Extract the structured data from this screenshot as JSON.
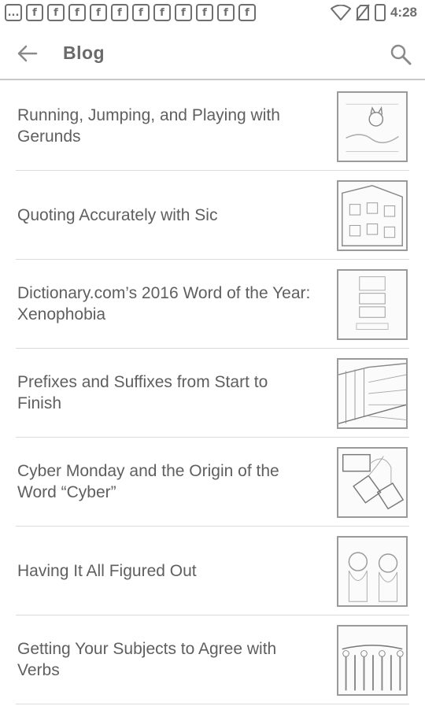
{
  "status_bar": {
    "notification_icons": [
      "...",
      "f",
      "f",
      "f",
      "f",
      "f",
      "f",
      "f",
      "f",
      "f",
      "f",
      "f"
    ],
    "time": "4:28"
  },
  "toolbar": {
    "title": "Blog"
  },
  "posts": [
    {
      "title": "Running, Jumping, and Playing with Gerunds",
      "thumb": "cat-illustration"
    },
    {
      "title": "Quoting Accurately with Sic",
      "thumb": "building-illustration"
    },
    {
      "title": "Dictionary.com’s 2016 Word of the Year: Xenophobia",
      "thumb": "word-of-year-badge"
    },
    {
      "title": "Prefixes and Suffixes from Start to Finish",
      "thumb": "city-perspective"
    },
    {
      "title": "Cyber Monday and the Origin of the Word “Cyber”",
      "thumb": "sale-tags"
    },
    {
      "title": "Having It All Figured Out",
      "thumb": "puppies-photo"
    },
    {
      "title": "Getting Your Subjects to Agree with Verbs",
      "thumb": "crowd-illustration"
    }
  ]
}
